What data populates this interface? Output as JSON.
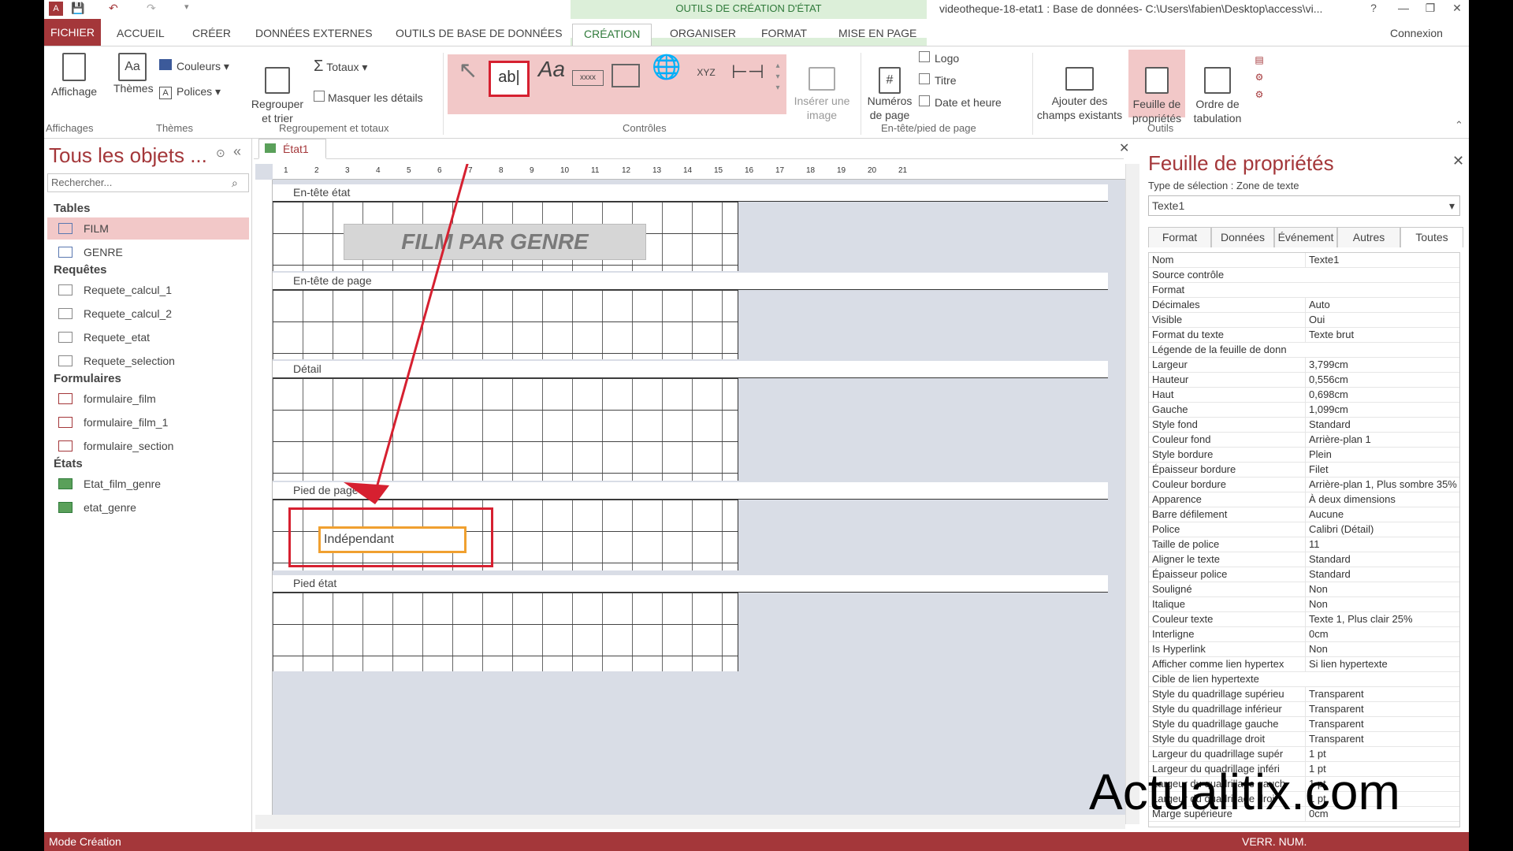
{
  "titlebar": {
    "context_tools": "OUTILS DE CRÉATION D'ÉTAT",
    "window_title": "videotheque-18-etat1 : Base de données- C:\\Users\\fabien\\Desktop\\access\\vi...",
    "help": "?",
    "minimize": "—",
    "restore": "❐",
    "close": "✕"
  },
  "tabs": {
    "fichier": "FICHIER",
    "accueil": "ACCUEIL",
    "creer": "CRÉER",
    "donnees_externes": "DONNÉES EXTERNES",
    "outils_bdd": "OUTILS DE BASE DE DONNÉES",
    "creation": "CRÉATION",
    "organiser": "ORGANISER",
    "format": "FORMAT",
    "mise_en_page": "MISE EN PAGE",
    "connexion": "Connexion"
  },
  "ribbon": {
    "affichage": "Affichage",
    "themes": "Thèmes",
    "couleurs": "Couleurs",
    "polices": "Polices",
    "regrouper": "Regrouper\net trier",
    "totaux": "Totaux",
    "masquer": "Masquer les détails",
    "inserer_image": "Insérer une\nimage",
    "numeros": "Numéros\nde page",
    "logo": "Logo",
    "titre": "Titre",
    "date_heure": "Date et heure",
    "ajouter_champs": "Ajouter des\nchamps existants",
    "feuille_prop": "Feuille de\npropriétés",
    "ordre_tab": "Ordre de\ntabulation",
    "groups": {
      "affichages": "Affichages",
      "themes": "Thèmes",
      "regroupement": "Regroupement et totaux",
      "controles": "Contrôles",
      "entete_pied": "En-tête/pied de page",
      "outils": "Outils"
    },
    "ctrl_textbox": "ab|",
    "ctrl_label": "Aa",
    "ctrl_xxxx": "xxxx",
    "ctrl_xyz": "XYZ"
  },
  "nav": {
    "title": "Tous les objets ...",
    "search_placeholder": "Rechercher...",
    "tables_head": "Tables",
    "tables": [
      "FILM",
      "GENRE"
    ],
    "requetes_head": "Requêtes",
    "requetes": [
      "Requete_calcul_1",
      "Requete_calcul_2",
      "Requete_etat",
      "Requete_selection"
    ],
    "formulaires_head": "Formulaires",
    "formulaires": [
      "formulaire_film",
      "formulaire_film_1",
      "formulaire_section"
    ],
    "etats_head": "États",
    "etats": [
      "Etat_film_genre",
      "etat_genre"
    ]
  },
  "doc": {
    "tab": "État1",
    "close": "✕",
    "sections": [
      "En-tête état",
      "En-tête de page",
      "Détail",
      "Pied de page",
      "Pied état"
    ],
    "report_title": "FILM PAR GENRE",
    "textbox_label": "Indépendant",
    "ruler": [
      "1",
      "2",
      "3",
      "4",
      "5",
      "6",
      "7",
      "8",
      "9",
      "10",
      "11",
      "12",
      "13",
      "14",
      "15",
      "16",
      "17",
      "18",
      "19",
      "20",
      "21"
    ]
  },
  "props": {
    "title": "Feuille de propriétés",
    "selection_type": "Type de sélection :  Zone de texte",
    "selected": "Texte1",
    "tabs": [
      "Format",
      "Données",
      "Événement",
      "Autres",
      "Toutes"
    ],
    "rows": [
      [
        "Nom",
        "Texte1"
      ],
      [
        "Source contrôle",
        ""
      ],
      [
        "Format",
        ""
      ],
      [
        "Décimales",
        "Auto"
      ],
      [
        "Visible",
        "Oui"
      ],
      [
        "Format du texte",
        "Texte brut"
      ],
      [
        "Légende de la feuille de donn",
        ""
      ],
      [
        "Largeur",
        "3,799cm"
      ],
      [
        "Hauteur",
        "0,556cm"
      ],
      [
        "Haut",
        "0,698cm"
      ],
      [
        "Gauche",
        "1,099cm"
      ],
      [
        "Style fond",
        "Standard"
      ],
      [
        "Couleur fond",
        "Arrière-plan 1"
      ],
      [
        "Style bordure",
        "Plein"
      ],
      [
        "Épaisseur bordure",
        "Filet"
      ],
      [
        "Couleur bordure",
        "Arrière-plan 1, Plus sombre 35%"
      ],
      [
        "Apparence",
        "À deux dimensions"
      ],
      [
        "Barre défilement",
        "Aucune"
      ],
      [
        "Police",
        "Calibri (Détail)"
      ],
      [
        "Taille de police",
        "11"
      ],
      [
        "Aligner le texte",
        "Standard"
      ],
      [
        "Épaisseur police",
        "Standard"
      ],
      [
        "Souligné",
        "Non"
      ],
      [
        "Italique",
        "Non"
      ],
      [
        "Couleur texte",
        "Texte 1, Plus clair 25%"
      ],
      [
        "Interligne",
        "0cm"
      ],
      [
        "Is Hyperlink",
        "Non"
      ],
      [
        "Afficher comme lien hypertex",
        "Si lien hypertexte"
      ],
      [
        "Cible de lien hypertexte",
        ""
      ],
      [
        "Style du quadrillage supérieu",
        "Transparent"
      ],
      [
        "Style du quadrillage inférieur",
        "Transparent"
      ],
      [
        "Style du quadrillage gauche",
        "Transparent"
      ],
      [
        "Style du quadrillage droit",
        "Transparent"
      ],
      [
        "Largeur du quadrillage supér",
        "1 pt"
      ],
      [
        "Largeur du quadrillage inféri",
        "1 pt"
      ],
      [
        "Largeur du quadrillage gauch",
        "1 pt"
      ],
      [
        "Largeur du quadrillage droi",
        "1 pt"
      ],
      [
        "Marge supérieure",
        "0cm"
      ]
    ]
  },
  "status": {
    "mode": "Mode Création",
    "verr": "VERR. NUM."
  },
  "watermark": "Actualitix.com",
  "colors": {
    "accent": "#a4373a",
    "context_green": "#2f7a3a",
    "highlight_red": "#d62030",
    "selection_orange": "#f0a030"
  }
}
